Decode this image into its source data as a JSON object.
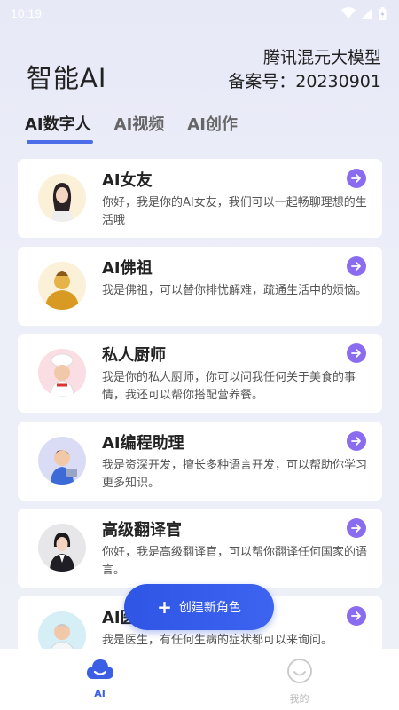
{
  "status": {
    "time": "10:19"
  },
  "header": {
    "title": "智能AI",
    "model_name": "腾讯混元大模型",
    "record_no": "备案号：20230901"
  },
  "tabs": [
    {
      "label": "AI数字人",
      "active": true
    },
    {
      "label": "AI视频",
      "active": false
    },
    {
      "label": "AI创作",
      "active": false
    }
  ],
  "cards": [
    {
      "title": "AI女友",
      "desc": "你好，我是你的AI女友，我们可以一起畅聊理想的生活哦",
      "avatar": "girlfriend-avatar"
    },
    {
      "title": "AI佛祖",
      "desc": "我是佛祖，可以替你排忧解难，疏通生活中的烦恼。",
      "avatar": "buddha-avatar"
    },
    {
      "title": "私人厨师",
      "desc": "我是你的私人厨师，你可以问我任何关于美食的事情，我还可以帮你搭配营养餐。",
      "avatar": "chef-avatar"
    },
    {
      "title": "AI编程助理",
      "desc": "我是资深开发，擅长多种语言开发，可以帮助你学习更多知识。",
      "avatar": "programmer-avatar"
    },
    {
      "title": "高级翻译官",
      "desc": "你好，我是高级翻译官，可以帮你翻译任何国家的语言。",
      "avatar": "translator-avatar"
    },
    {
      "title": "AI医生",
      "desc": "我是医生，有任何生病的症状都可以来询问。",
      "avatar": "doctor-avatar"
    }
  ],
  "fab": {
    "label": "创建新角色"
  },
  "nav": [
    {
      "label": "AI",
      "active": true,
      "icon": "ai-cloud-icon"
    },
    {
      "label": "我的",
      "active": false,
      "icon": "smiley-icon"
    }
  ],
  "colors": {
    "accent": "#3a5fe5",
    "arrow_button": "#8a6cf0",
    "tab_underline": "#4b6ee8"
  }
}
